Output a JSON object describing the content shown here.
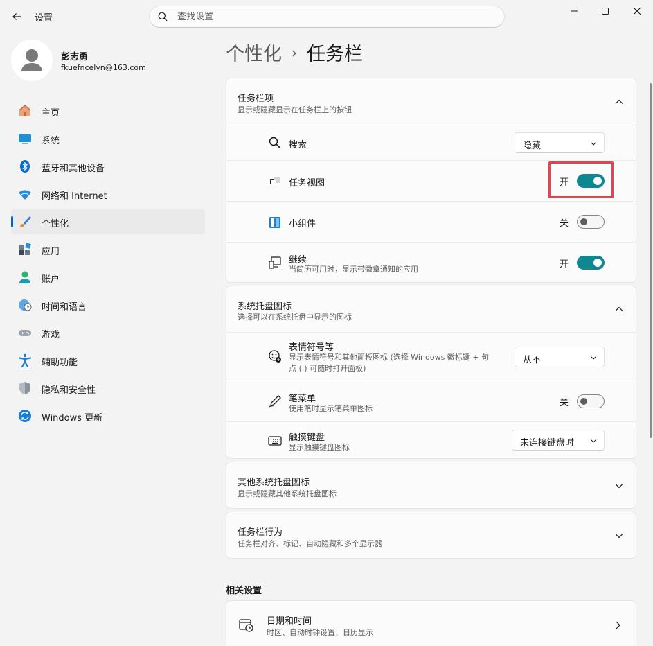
{
  "window": {
    "app_title": "设置",
    "back_icon": "arrow-left-icon",
    "controls": [
      "minimize-icon",
      "maximize-icon",
      "close-icon"
    ]
  },
  "search": {
    "placeholder": "查找设置",
    "icon": "search-icon"
  },
  "user": {
    "name": "彭志勇",
    "email": "fkuefncelyn@163.com"
  },
  "sidebar": {
    "items": [
      {
        "label": "主页",
        "icon": "home-icon"
      },
      {
        "label": "系统",
        "icon": "monitor-icon"
      },
      {
        "label": "蓝牙和其他设备",
        "icon": "bluetooth-icon"
      },
      {
        "label": "网络和 Internet",
        "icon": "wifi-icon"
      },
      {
        "label": "个性化",
        "icon": "brush-icon",
        "active": true
      },
      {
        "label": "应用",
        "icon": "apps-icon"
      },
      {
        "label": "账户",
        "icon": "person-icon"
      },
      {
        "label": "时间和语言",
        "icon": "globe-clock-icon"
      },
      {
        "label": "游戏",
        "icon": "gamepad-icon"
      },
      {
        "label": "辅助功能",
        "icon": "accessibility-icon"
      },
      {
        "label": "隐私和安全性",
        "icon": "shield-icon"
      },
      {
        "label": "Windows 更新",
        "icon": "update-icon"
      }
    ]
  },
  "breadcrumb": {
    "parent": "个性化",
    "separator": "›",
    "current": "任务栏"
  },
  "taskbar_items": {
    "title": "任务栏项",
    "subtitle": "显示或隐藏显示在任务栏上的按钮",
    "rows": {
      "search": {
        "label": "搜索",
        "value": "隐藏"
      },
      "task_view": {
        "label": "任务视图",
        "state": "开"
      },
      "widgets": {
        "label": "小组件",
        "state": "关"
      },
      "continue": {
        "label": "继续",
        "subtitle": "当简历可用时，显示带徽章通知的应用",
        "state": "开"
      }
    }
  },
  "tray_icons": {
    "title": "系统托盘图标",
    "subtitle": "选择可以在系统托盘中显示的图标",
    "rows": {
      "emoji": {
        "label": "表情符号等",
        "subtitle_line1": "显示表情符号和其他面板图标 (选择 Windows 徽标键 + 句",
        "subtitle_line2": "点 (.) 可随时打开面板)",
        "value": "从不"
      },
      "pen": {
        "label": "笔菜单",
        "subtitle": "使用笔时显示笔菜单图标",
        "state": "关"
      },
      "touch_keyboard": {
        "label": "触摸键盘",
        "subtitle": "显示触摸键盘图标",
        "value": "未连接键盘时"
      }
    }
  },
  "other_tray": {
    "title": "其他系统托盘图标",
    "subtitle": "显示或隐藏其他系统托盘图标"
  },
  "taskbar_behaviors": {
    "title": "任务栏行为",
    "subtitle": "任务栏对齐、标记、自动隐藏和多个显示器"
  },
  "related": {
    "label": "相关设置",
    "date_time": {
      "title": "日期和时间",
      "subtitle": "时区、自动时钟设置、日历显示"
    }
  },
  "colors": {
    "accent": "#0f8791",
    "highlight": "#e8424d"
  }
}
